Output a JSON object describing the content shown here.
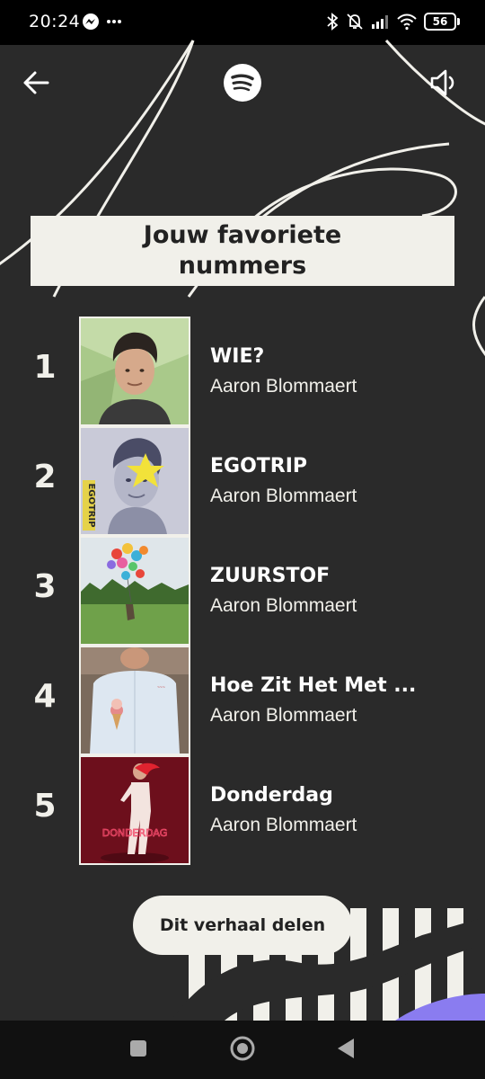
{
  "status_bar": {
    "time": "20:24",
    "battery": "56",
    "icons": [
      "messenger-icon",
      "more-dots-icon",
      "bluetooth-icon",
      "bell-muted-icon",
      "signal-icon",
      "wifi-icon",
      "battery-icon"
    ]
  },
  "header": {
    "back_icon": "arrow-left-icon",
    "logo_icon": "spotify-logo-icon",
    "sound_icon": "speaker-icon"
  },
  "title": {
    "line1": "Jouw favoriete",
    "line2": "nummers"
  },
  "tracks": [
    {
      "rank": "1",
      "title": "WIE?",
      "artist": "Aaron Blommaert"
    },
    {
      "rank": "2",
      "title": "EGOTRIP",
      "artist": "Aaron Blommaert"
    },
    {
      "rank": "3",
      "title": "ZUURSTOF",
      "artist": "Aaron Blommaert"
    },
    {
      "rank": "4",
      "title": "Hoe Zit Het Met ...",
      "artist": "Aaron Blommaert"
    },
    {
      "rank": "5",
      "title": "Donderdag",
      "artist": "Aaron Blommaert"
    }
  ],
  "covers": {
    "cover2_text": "EGOTRIP",
    "cover5_text": "DONDERDAG"
  },
  "share": {
    "label": "Dit verhaal delen"
  },
  "nav": {
    "icons": [
      "square-recents-icon",
      "circle-home-icon",
      "triangle-back-icon"
    ]
  },
  "colors": {
    "background": "#2a2a2a",
    "card": "#f1f0ea",
    "text": "#ffffff",
    "accent_purple": "#8a7cf0"
  }
}
